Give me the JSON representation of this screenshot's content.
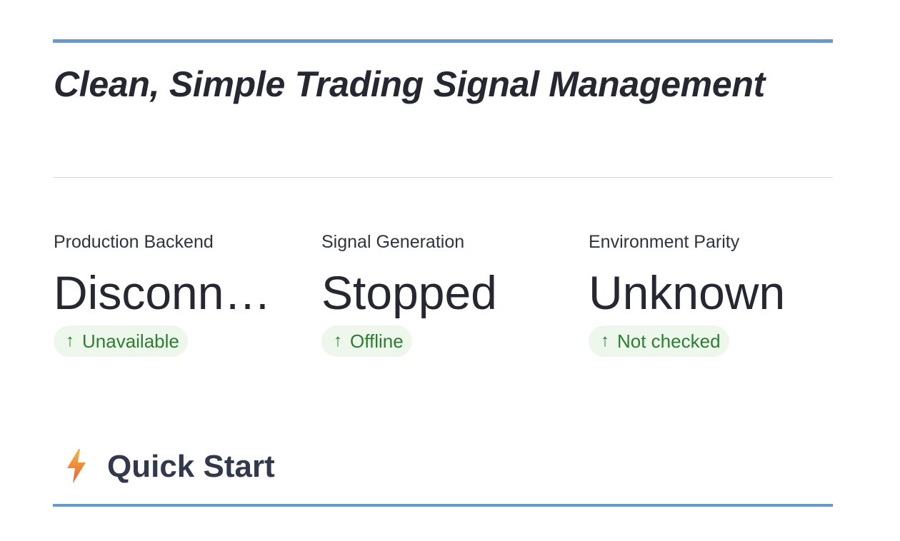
{
  "header": {
    "title": "Clean, Simple Trading Signal Management"
  },
  "metrics": [
    {
      "label": "Production Backend",
      "value": "Disconnected",
      "delta": "Unavailable"
    },
    {
      "label": "Signal Generation",
      "value": "Stopped",
      "delta": "Offline"
    },
    {
      "label": "Environment Parity",
      "value": "Unknown",
      "delta": "Not checked"
    }
  ],
  "quick_start": {
    "icon": "lightning-icon",
    "title": "Quick Start"
  },
  "colors": {
    "accent_rule": "#6699cc",
    "delta_text": "#2e7d32",
    "delta_bg": "#eef7ec"
  },
  "icons": {
    "delta_arrow": "arrow-up-icon"
  }
}
